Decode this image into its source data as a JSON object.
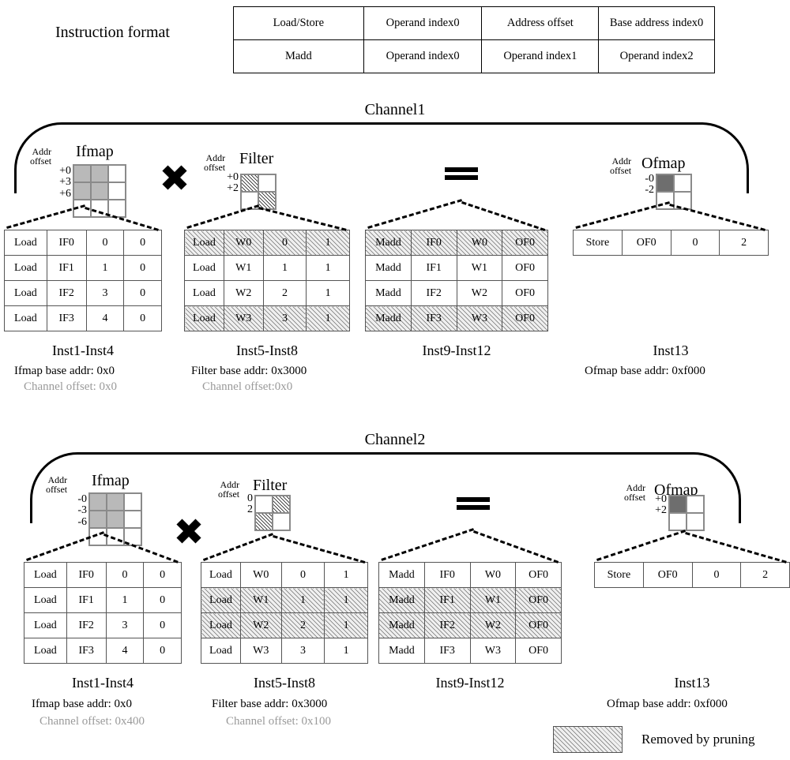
{
  "instruction_format": {
    "label": "Instruction format",
    "rows": [
      [
        "Load/Store",
        "Operand index0",
        "Address offset",
        "Base address index0"
      ],
      [
        "Madd",
        "Operand index0",
        "Operand index1",
        "Operand index2"
      ]
    ]
  },
  "legend": {
    "text": "Removed by pruning",
    "swatch": "hatched"
  },
  "operators": {
    "multiply": "multiply-x-symbol",
    "equals": "equals-symbol"
  },
  "channels": [
    {
      "title": "Channel1",
      "ifmap": {
        "title": "Ifmap",
        "addr_label": "Addr offset",
        "offsets": [
          "+0",
          "+3",
          "+6"
        ],
        "cells": [
          "gray",
          "gray",
          "white",
          "gray",
          "gray",
          "white",
          "white",
          "white",
          "white"
        ]
      },
      "filter": {
        "title": "Filter",
        "addr_label": "Addr offset",
        "offsets": [
          "+0",
          "+2"
        ],
        "cells": [
          "hatch",
          "white",
          "white",
          "hatch"
        ]
      },
      "ofmap": {
        "title": "Ofmap",
        "addr_label": "Addr offset",
        "offsets": [
          "-0",
          "-2"
        ],
        "cells": [
          "dark",
          "white",
          "white",
          "white"
        ]
      },
      "tables": [
        {
          "name": "ifmap-load-table",
          "caption": "Inst1-Inst4",
          "base_addr": "Ifmap base addr: 0x0",
          "channel_offset": "Channel offset: 0x0",
          "rows": [
            {
              "cells": [
                "Load",
                "IF0",
                "0",
                "0"
              ],
              "pruned": false
            },
            {
              "cells": [
                "Load",
                "IF1",
                "1",
                "0"
              ],
              "pruned": false
            },
            {
              "cells": [
                "Load",
                "IF2",
                "3",
                "0"
              ],
              "pruned": false
            },
            {
              "cells": [
                "Load",
                "IF3",
                "4",
                "0"
              ],
              "pruned": false
            }
          ]
        },
        {
          "name": "filter-load-table",
          "caption": "Inst5-Inst8",
          "base_addr": "Filter base addr: 0x3000",
          "channel_offset": "Channel offset:0x0",
          "rows": [
            {
              "cells": [
                "Load",
                "W0",
                "0",
                "1"
              ],
              "pruned": true
            },
            {
              "cells": [
                "Load",
                "W1",
                "1",
                "1"
              ],
              "pruned": false
            },
            {
              "cells": [
                "Load",
                "W2",
                "2",
                "1"
              ],
              "pruned": false
            },
            {
              "cells": [
                "Load",
                "W3",
                "3",
                "1"
              ],
              "pruned": true
            }
          ]
        },
        {
          "name": "madd-table",
          "caption": "Inst9-Inst12",
          "base_addr": "",
          "channel_offset": "",
          "rows": [
            {
              "cells": [
                "Madd",
                "IF0",
                "W0",
                "OF0"
              ],
              "pruned": true
            },
            {
              "cells": [
                "Madd",
                "IF1",
                "W1",
                "OF0"
              ],
              "pruned": false
            },
            {
              "cells": [
                "Madd",
                "IF2",
                "W2",
                "OF0"
              ],
              "pruned": false
            },
            {
              "cells": [
                "Madd",
                "IF3",
                "W3",
                "OF0"
              ],
              "pruned": true
            }
          ]
        },
        {
          "name": "ofmap-store-table",
          "caption": "Inst13",
          "base_addr": "Ofmap base addr: 0xf000",
          "channel_offset": "",
          "rows": [
            {
              "cells": [
                "Store",
                "OF0",
                "0",
                "2"
              ],
              "pruned": false
            }
          ]
        }
      ]
    },
    {
      "title": "Channel2",
      "ifmap": {
        "title": "Ifmap",
        "addr_label": "Addr offset",
        "offsets": [
          "-0",
          "-3",
          "-6"
        ],
        "cells": [
          "gray",
          "gray",
          "white",
          "gray",
          "gray",
          "white",
          "white",
          "white",
          "white"
        ]
      },
      "filter": {
        "title": "Filter",
        "addr_label": "Addr offset",
        "offsets": [
          "0",
          "2"
        ],
        "cells": [
          "white",
          "hatch",
          "hatch",
          "white"
        ]
      },
      "ofmap": {
        "title": "Ofmap",
        "addr_label": "Addr offset",
        "offsets": [
          "+0",
          "+2"
        ],
        "cells": [
          "dark",
          "white",
          "white",
          "white"
        ]
      },
      "tables": [
        {
          "name": "ifmap-load-table",
          "caption": "Inst1-Inst4",
          "base_addr": "Ifmap base addr: 0x0",
          "channel_offset": "Channel offset: 0x400",
          "rows": [
            {
              "cells": [
                "Load",
                "IF0",
                "0",
                "0"
              ],
              "pruned": false
            },
            {
              "cells": [
                "Load",
                "IF1",
                "1",
                "0"
              ],
              "pruned": false
            },
            {
              "cells": [
                "Load",
                "IF2",
                "3",
                "0"
              ],
              "pruned": false
            },
            {
              "cells": [
                "Load",
                "IF3",
                "4",
                "0"
              ],
              "pruned": false
            }
          ]
        },
        {
          "name": "filter-load-table",
          "caption": "Inst5-Inst8",
          "base_addr": "Filter base addr: 0x3000",
          "channel_offset": "Channel offset: 0x100",
          "rows": [
            {
              "cells": [
                "Load",
                "W0",
                "0",
                "1"
              ],
              "pruned": false
            },
            {
              "cells": [
                "Load",
                "W1",
                "1",
                "1"
              ],
              "pruned": true
            },
            {
              "cells": [
                "Load",
                "W2",
                "2",
                "1"
              ],
              "pruned": true
            },
            {
              "cells": [
                "Load",
                "W3",
                "3",
                "1"
              ],
              "pruned": false
            }
          ]
        },
        {
          "name": "madd-table",
          "caption": "Inst9-Inst12",
          "base_addr": "",
          "channel_offset": "",
          "rows": [
            {
              "cells": [
                "Madd",
                "IF0",
                "W0",
                "OF0"
              ],
              "pruned": false
            },
            {
              "cells": [
                "Madd",
                "IF1",
                "W1",
                "OF0"
              ],
              "pruned": true
            },
            {
              "cells": [
                "Madd",
                "IF2",
                "W2",
                "OF0"
              ],
              "pruned": true
            },
            {
              "cells": [
                "Madd",
                "IF3",
                "W3",
                "OF0"
              ],
              "pruned": false
            }
          ]
        },
        {
          "name": "ofmap-store-table",
          "caption": "Inst13",
          "base_addr": "Ofmap base addr: 0xf000",
          "channel_offset": "",
          "rows": [
            {
              "cells": [
                "Store",
                "OF0",
                "0",
                "2"
              ],
              "pruned": false
            }
          ]
        }
      ]
    }
  ]
}
